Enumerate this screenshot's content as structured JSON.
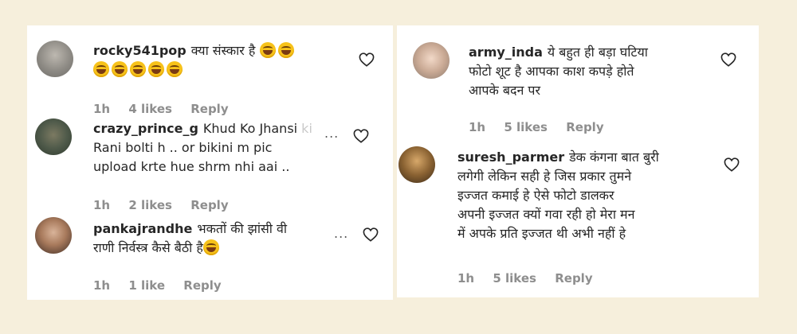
{
  "left_panel": {
    "comments": [
      {
        "username": "rocky541pop",
        "text": "क्या संस्कार है",
        "emoji_count": 7,
        "time": "1h",
        "likes": "4 likes",
        "reply": "Reply"
      },
      {
        "username": "crazy_prince_g",
        "text_line1": "Khud Ko Jhansi",
        "text_line1_faded": " ki",
        "text_line2": "Rani bolti h .. or bikini m pic",
        "text_line3": "upload krte hue shrm nhi aai ..",
        "more": "...",
        "time": "1h",
        "likes": "2 likes",
        "reply": "Reply"
      },
      {
        "username": "pankajrandhe",
        "text_line1": "भकतों की झांसी व",
        "text_line1_faded": "ी",
        "text_line2": "राणी निर्वस्त्र कैसे बैठी है",
        "emoji_count": 1,
        "more": "...",
        "time": "1h",
        "likes": "1 like",
        "reply": "Reply"
      }
    ]
  },
  "right_panel": {
    "comments": [
      {
        "username": "army_inda",
        "text_line1": "ये बहुत ही बड़ा घटिया",
        "text_line2": "फोटो शूट है आपका काश कपड़े होते",
        "text_line3": "आपके बदन पर",
        "time": "1h",
        "likes": "5 likes",
        "reply": "Reply"
      },
      {
        "username": "suresh_parmer",
        "text_line1": "डेक कंगना बात बुरी",
        "text_line2": "लगेगी लेकिन सही हे जिस प्रकार तुमने",
        "text_line3": "इज्जत कमाई हे ऐसे फोटो डालकर",
        "text_line4": "अपनी इज्जत क्यों गवा रही हो मेरा मन",
        "text_line5": "में अपके प्रति इज्जत थी अभी नहीं हे",
        "time": "1h",
        "likes": "5 likes",
        "reply": "Reply"
      }
    ]
  },
  "icons": {
    "heart": "heart-outline-icon",
    "emoji": "laughing-tears-emoji-icon",
    "more": "more-options-icon"
  }
}
